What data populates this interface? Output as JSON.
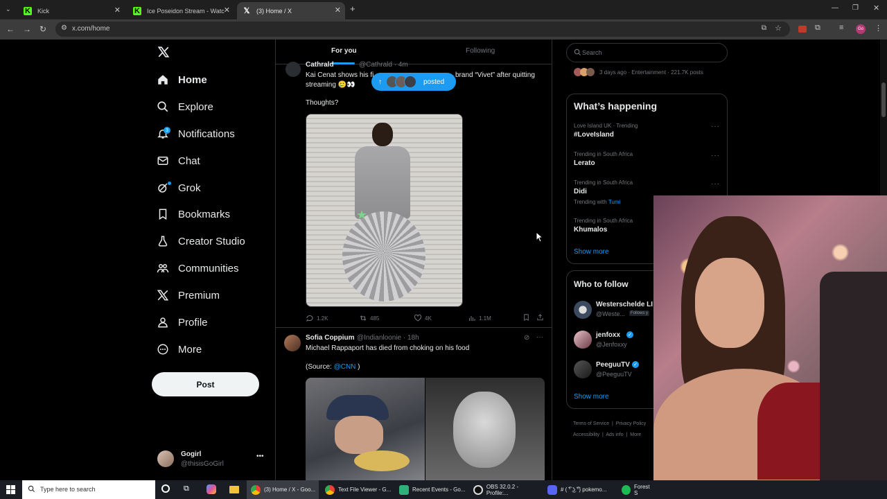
{
  "browser": {
    "tabs": [
      {
        "title": "Kick",
        "icon": "kick-icon"
      },
      {
        "title": "Ice Poseidon Stream - Watch Li",
        "icon": "kick-icon"
      },
      {
        "title": "(3) Home / X",
        "icon": "x-icon"
      }
    ],
    "url": "x.com/home"
  },
  "nav": {
    "items": [
      {
        "label": "Home",
        "icon": "home-icon"
      },
      {
        "label": "Explore",
        "icon": "search-icon"
      },
      {
        "label": "Notifications",
        "icon": "bell-icon",
        "badge": "3"
      },
      {
        "label": "Chat",
        "icon": "mail-icon"
      },
      {
        "label": "Grok",
        "icon": "grok-icon"
      },
      {
        "label": "Bookmarks",
        "icon": "bookmark-icon"
      },
      {
        "label": "Creator Studio",
        "icon": "flask-icon"
      },
      {
        "label": "Communities",
        "icon": "people-icon"
      },
      {
        "label": "Premium",
        "icon": "x-icon"
      },
      {
        "label": "Profile",
        "icon": "person-icon"
      },
      {
        "label": "More",
        "icon": "more-circle-icon"
      }
    ],
    "post_label": "Post",
    "account": {
      "name": "Gogirl",
      "handle": "@thisisGoGirl"
    }
  },
  "feed": {
    "tabs": [
      "For you",
      "Following"
    ],
    "posted_pill": "posted",
    "tweet1": {
      "author": "Cathrald",
      "handle": "@Cathrald · 4m",
      "text_a": "Kai Cenat shows his fi",
      "text_b": "brand “Vivet” after quitting",
      "text_line2": "streaming 🥲👀",
      "text_thoughts": "Thoughts?",
      "replies": "1.2K",
      "reposts": "485",
      "likes": "4K",
      "views": "1.1M"
    },
    "tweet2": {
      "author": "Sofia Coppium",
      "handle": "@Indianloonie · 18h",
      "text": "Michael Rappaport has died from choking on his food",
      "source_prefix": "(Source: ",
      "source_link": "@CNN",
      "source_suffix": " )"
    }
  },
  "sidebar": {
    "search_placeholder": "Search",
    "top_meta": "3 days ago · Entertainment · 221.7K posts",
    "happening_title": "What’s happening",
    "trends": [
      {
        "category": "Love Island UK · Trending",
        "name": "#LoveIsland",
        "extra": ""
      },
      {
        "category": "Trending in South Africa",
        "name": "Lerato",
        "extra": ""
      },
      {
        "category": "Trending in South Africa",
        "name": "Didi",
        "extra": "Trending with"
      },
      {
        "category": "Trending in South Africa",
        "name": "Khumalos",
        "extra": ""
      }
    ],
    "trend_extra_link": "Tumi",
    "show_more": "Show more",
    "follow_title": "Who to follow",
    "follow": [
      {
        "name": "Westerschelde LI",
        "handle": "@Weste...",
        "badge": "Follows y"
      },
      {
        "name": "jenfoxx",
        "handle": "@Jenfoxxy",
        "badge": ""
      },
      {
        "name": "PeeguuTV",
        "handle": "@PeeguuTV",
        "badge": ""
      }
    ],
    "footer": [
      "Terms of Service",
      "Privacy Policy",
      "Accessibility",
      "Ads info",
      "More"
    ]
  },
  "taskbar": {
    "search_placeholder": "Type here to search",
    "apps": [
      {
        "label": "(3) Home / X - Goo..."
      },
      {
        "label": "Text File Viewer - G..."
      },
      {
        "label": "Recent Events - Go..."
      },
      {
        "label": "OBS 32.0.2 - Profile:..."
      },
      {
        "label": "# ( ͡° ͜ʖ ͡°) pokemo..."
      },
      {
        "label": "Forest S"
      }
    ]
  },
  "colors": {
    "accent": "#1d9bf0",
    "border": "#2f3336",
    "muted": "#71767b"
  }
}
